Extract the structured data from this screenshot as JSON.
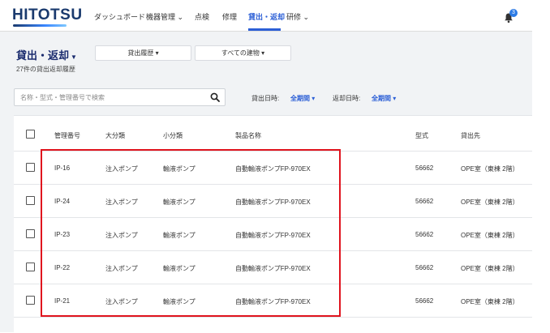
{
  "app": {
    "logo": "HITOTSU"
  },
  "nav": {
    "dashboard": "ダッシュボード",
    "equipment": "機器管理",
    "inspection": "点検",
    "repair": "修理",
    "lending": "貸出・返却",
    "training": "研修"
  },
  "notifications": {
    "count": "3"
  },
  "page": {
    "title": "貸出・返却",
    "subtitle": "27件の貸出返却履歴",
    "lending_history_btn": "貸出履歴",
    "buildings_btn": "すべての建物"
  },
  "search": {
    "placeholder": "名称・型式・管理番号で検索"
  },
  "filters": {
    "lend_date_label": "貸出日時:",
    "lend_date_value": "全期間",
    "return_date_label": "返却日時:",
    "return_date_value": "全期間"
  },
  "table": {
    "headers": {
      "id": "管理番号",
      "major": "大分類",
      "minor": "小分類",
      "product": "製品名称",
      "model": "型式",
      "lent_to": "貸出先"
    },
    "rows": [
      {
        "id": "IP-16",
        "major": "注入ポンプ",
        "minor": "輸液ポンプ",
        "product": "自動輸液ポンプFP-970EX",
        "model": "56662",
        "lent_to": "OPE室（東棟 2階）"
      },
      {
        "id": "IP-24",
        "major": "注入ポンプ",
        "minor": "輸液ポンプ",
        "product": "自動輸液ポンプFP-970EX",
        "model": "56662",
        "lent_to": "OPE室（東棟 2階）"
      },
      {
        "id": "IP-23",
        "major": "注入ポンプ",
        "minor": "輸液ポンプ",
        "product": "自動輸液ポンプFP-970EX",
        "model": "56662",
        "lent_to": "OPE室（東棟 2階）"
      },
      {
        "id": "IP-22",
        "major": "注入ポンプ",
        "minor": "輸液ポンプ",
        "product": "自動輸液ポンプFP-970EX",
        "model": "56662",
        "lent_to": "OPE室（東棟 2階）"
      },
      {
        "id": "IP-21",
        "major": "注入ポンプ",
        "minor": "輸液ポンプ",
        "product": "自動輸液ポンプFP-970EX",
        "model": "56662",
        "lent_to": "OPE室（東棟 2階）"
      }
    ]
  },
  "colors": {
    "accent": "#2c5fd6",
    "brand": "#1a3a6e",
    "highlight": "#e0141e"
  }
}
